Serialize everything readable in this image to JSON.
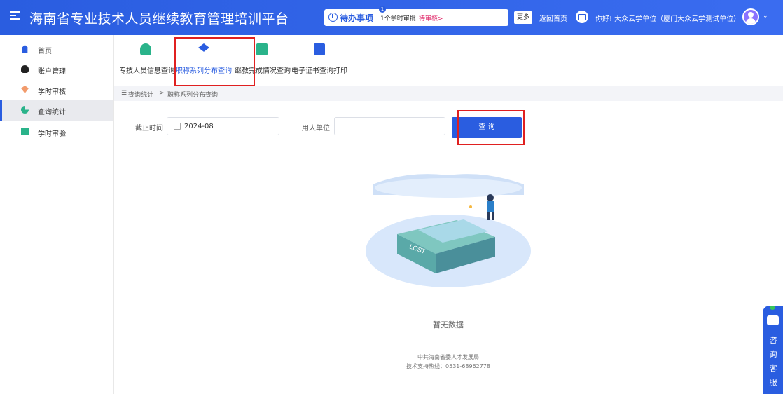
{
  "header": {
    "app_title": "海南省专业技术人员继续教育管理培训平台",
    "todo_label": "待办事项",
    "todo_badge": "1",
    "todo_item": "1个学时审批",
    "todo_link": "待审核>",
    "more_label": "更多",
    "home_link": "返回首页",
    "greeting": "你好! 大众云学单位（厦门大众云学测试单位）"
  },
  "sidebar": {
    "items": [
      {
        "label": "首页",
        "icon": "home-icon"
      },
      {
        "label": "账户管理",
        "icon": "user-icon"
      },
      {
        "label": "学时审核",
        "icon": "diamond-icon"
      },
      {
        "label": "查询统计",
        "icon": "pie-chart-icon",
        "active": true
      },
      {
        "label": "学时审验",
        "icon": "document-icon"
      }
    ]
  },
  "toolbar": {
    "items": [
      {
        "label": "专技人员信息查询",
        "icon": "user-search-icon"
      },
      {
        "label": "职称系列分布查询",
        "icon": "layers-search-icon",
        "active": true
      },
      {
        "label": "继教完成情况查询",
        "icon": "sheet-icon"
      },
      {
        "label": "电子证书查询打印",
        "icon": "printer-icon"
      }
    ]
  },
  "breadcrumb": {
    "root": "查询统计",
    "separator": ">",
    "current": "职称系列分布查询"
  },
  "filters": {
    "deadline_label": "截止时间",
    "deadline_value": "2024-08",
    "employer_label": "用人单位",
    "employer_value": "",
    "query_button": "查 询"
  },
  "empty_state": {
    "text": "暂无数据",
    "illustration_word": "LOST"
  },
  "footer": {
    "org": "中共海南省委人才发展局",
    "support": "技术支持热线：0531-68962778"
  },
  "chat": {
    "text": "咨 询 客 服"
  },
  "colors": {
    "primary": "#2a5de0",
    "accent_green": "#2ab38a",
    "highlight_red": "#e02020",
    "pending_pink": "#e02a6a"
  }
}
